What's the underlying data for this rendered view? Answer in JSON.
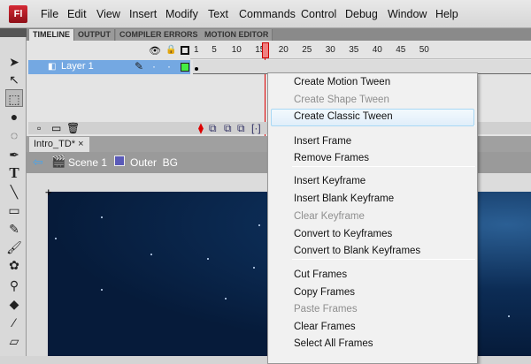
{
  "app": {
    "logo": "Fl"
  },
  "menubar": [
    "File",
    "Edit",
    "View",
    "Insert",
    "Modify",
    "Text",
    "Commands",
    "Control",
    "Debug",
    "Window",
    "Help"
  ],
  "panel_tabs": [
    "TIMELINE",
    "OUTPUT",
    "COMPILER ERRORS",
    "MOTION EDITOR"
  ],
  "ruler": [
    "1",
    "5",
    "10",
    "15",
    "20",
    "25",
    "30",
    "35",
    "40",
    "45",
    "50"
  ],
  "layer": {
    "name": "Layer 1",
    "color": "#44ee44"
  },
  "document": {
    "tab": "Intro_TD*",
    "close": "×",
    "scene": "Scene 1",
    "symbol": "Outer  BG"
  },
  "context_menu": [
    {
      "label": "Create Motion Tween",
      "enabled": true
    },
    {
      "label": "Create Shape Tween",
      "enabled": false
    },
    {
      "label": "Create Classic Tween",
      "enabled": true,
      "highlighted": true
    },
    {
      "label": "Insert Frame",
      "enabled": true
    },
    {
      "label": "Remove Frames",
      "enabled": true
    },
    {
      "label": "Insert Keyframe",
      "enabled": true
    },
    {
      "label": "Insert Blank Keyframe",
      "enabled": true
    },
    {
      "label": "Clear Keyframe",
      "enabled": false
    },
    {
      "label": "Convert to Keyframes",
      "enabled": true
    },
    {
      "label": "Convert to Blank Keyframes",
      "enabled": true
    },
    {
      "label": "Cut Frames",
      "enabled": true
    },
    {
      "label": "Copy Frames",
      "enabled": true
    },
    {
      "label": "Paste Frames",
      "enabled": false
    },
    {
      "label": "Clear Frames",
      "enabled": true
    },
    {
      "label": "Select All Frames",
      "enabled": true
    }
  ]
}
